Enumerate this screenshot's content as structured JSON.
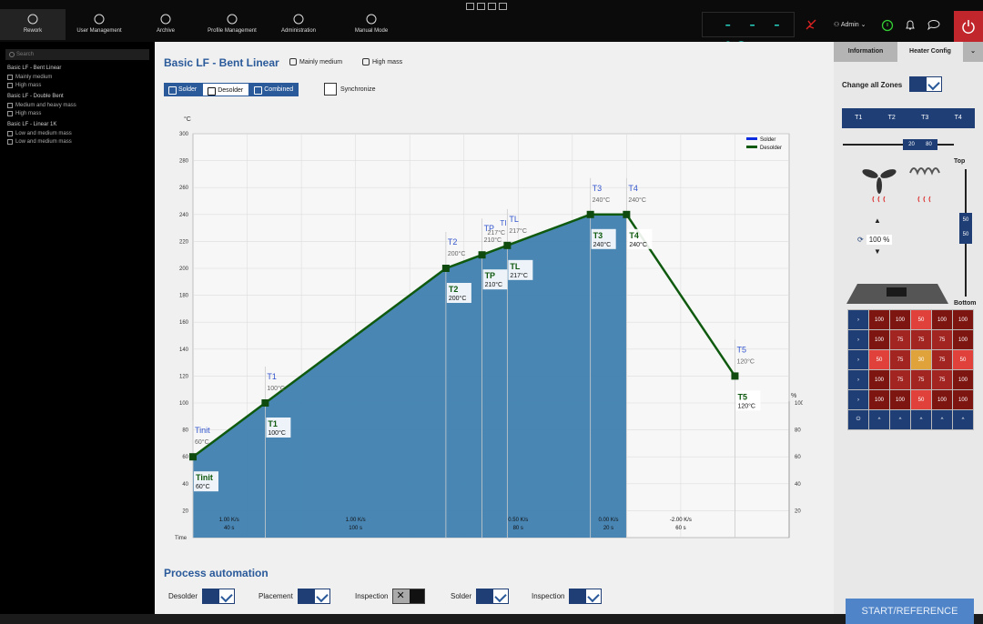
{
  "nav": [
    {
      "label": "Rework",
      "icon": "rework-icon"
    },
    {
      "label": "User Management",
      "icon": "users-icon"
    },
    {
      "label": "Archive",
      "icon": "archive-icon"
    },
    {
      "label": "Profile Management",
      "icon": "chart-icon"
    },
    {
      "label": "Administration",
      "icon": "gear-icon"
    },
    {
      "label": "Manual Mode",
      "icon": "hand-icon"
    }
  ],
  "header": {
    "temperature": "- - - °C",
    "user": "Admin"
  },
  "sidebar": {
    "search_placeholder": "Search",
    "groups": [
      {
        "title": "Basic LF - Bent Linear",
        "items": [
          "Mainly medium",
          "High mass"
        ]
      },
      {
        "title": "Basic LF - Double Bent",
        "items": [
          "Medium and heavy mass",
          "High mass"
        ]
      },
      {
        "title": "Basic LF - Linear 1K",
        "items": [
          "Low and medium mass",
          "Low and medium mass"
        ]
      }
    ]
  },
  "profile": {
    "title": "Basic LF - Bent Linear",
    "tags": [
      "Mainly medium",
      "High mass"
    ],
    "modes": [
      "Solder",
      "Desolder",
      "Combined"
    ],
    "selected_mode": "Desolder",
    "sync_label": "Synchronize"
  },
  "chart_data": {
    "type": "area",
    "ylabel": "°C",
    "y2label": "%",
    "xlabel": "Time",
    "ylim": [
      0,
      300
    ],
    "yticks": [
      20,
      40,
      60,
      80,
      100,
      120,
      140,
      160,
      180,
      200,
      220,
      240,
      260,
      280,
      300
    ],
    "y2ticks": [
      20,
      40,
      60,
      80,
      100
    ],
    "series": [
      {
        "name": "Solder",
        "color": "#0a2be0"
      },
      {
        "name": "Desolder",
        "color": "#0f5a0f"
      }
    ],
    "points": [
      {
        "name": "Tinit",
        "t": 0,
        "temp": 60,
        "label": "60°C"
      },
      {
        "name": "T1",
        "t": 40,
        "temp": 100,
        "label": "100°C"
      },
      {
        "name": "T2",
        "t": 140,
        "temp": 200,
        "label": "200°C"
      },
      {
        "name": "TP",
        "t": 160,
        "temp": 210,
        "label": "210°C"
      },
      {
        "name": "TL",
        "t": 174,
        "temp": 217,
        "label": "217°C"
      },
      {
        "name": "T3",
        "t": 220,
        "temp": 240,
        "label": "240°C"
      },
      {
        "name": "T4",
        "t": 240,
        "temp": 240,
        "label": "240°C"
      },
      {
        "name": "T5",
        "t": 300,
        "temp": 120,
        "label": "120°C"
      }
    ],
    "segments": [
      {
        "rate": "1.00 K/s",
        "dur": "40 s"
      },
      {
        "rate": "1.00 K/s",
        "dur": "100 s"
      },
      {
        "rate": "0.50 K/s",
        "dur": "80 s"
      },
      {
        "rate": "0.00 K/s",
        "dur": "20 s"
      },
      {
        "rate": "-2.00 K/s",
        "dur": "60 s"
      }
    ],
    "ti_label": "TI",
    "ti_value": "217°C"
  },
  "automation": {
    "title": "Process automation",
    "items": [
      {
        "label": "Desolder",
        "on": true
      },
      {
        "label": "Placement",
        "on": true
      },
      {
        "label": "Inspection",
        "on": false
      },
      {
        "label": "Solder",
        "on": true
      },
      {
        "label": "Inspection",
        "on": true
      }
    ]
  },
  "right": {
    "tabs": [
      "Information",
      "Heater Config"
    ],
    "change_all": "Change all Zones",
    "zones": [
      "T1",
      "T2",
      "T3",
      "T4"
    ],
    "slider": [
      "20",
      "80"
    ],
    "fan_pct": "100 %",
    "top": "Top",
    "bottom": "Bottom",
    "top_bottom": [
      "50",
      "50"
    ],
    "grid": [
      [
        "100",
        "100",
        "50",
        "100",
        "100"
      ],
      [
        "100",
        "75",
        "75",
        "75",
        "100"
      ],
      [
        "50",
        "75",
        "30",
        "75",
        "50"
      ],
      [
        "100",
        "75",
        "75",
        "75",
        "100"
      ],
      [
        "100",
        "100",
        "50",
        "100",
        "100"
      ]
    ],
    "start": "START/REFERENCE"
  }
}
